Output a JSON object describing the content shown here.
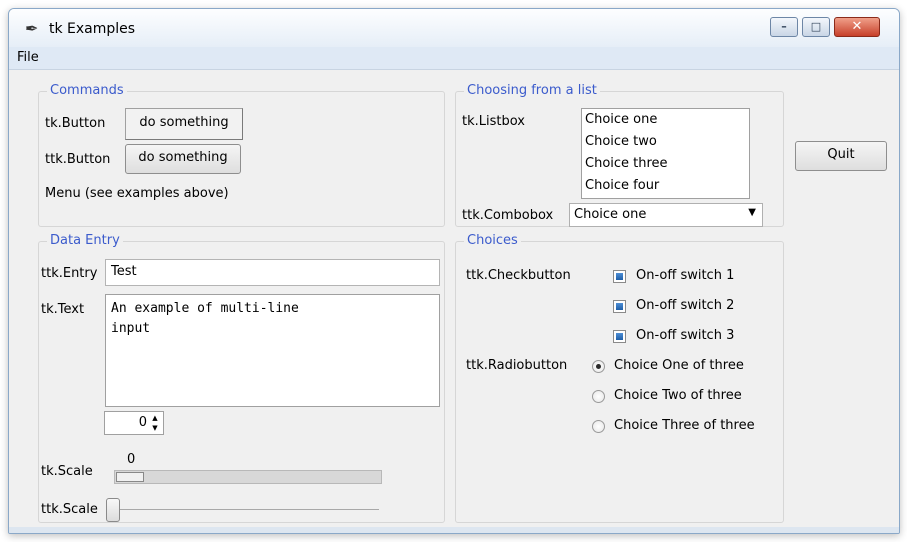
{
  "window": {
    "title": "tk Examples",
    "icon": "feather-icon",
    "controls": [
      "minimize-icon",
      "maximize-icon",
      "close-icon"
    ]
  },
  "menubar": {
    "items": [
      "File"
    ]
  },
  "commands": {
    "legend": "Commands",
    "tk_button_label": "tk.Button",
    "tk_button_text": "do something",
    "ttk_button_label": "ttk.Button",
    "ttk_button_text": "do something",
    "menu_note": "Menu (see examples above)"
  },
  "list": {
    "legend": "Choosing from a list",
    "listbox_label": "tk.Listbox",
    "listbox_items": [
      "Choice one",
      "Choice two",
      "Choice three",
      "Choice four"
    ],
    "combobox_label": "ttk.Combobox",
    "combobox_value": "Choice one"
  },
  "quit_label": "Quit",
  "data_entry": {
    "legend": "Data Entry",
    "entry_label": "ttk.Entry",
    "entry_value": "Test",
    "text_label": "tk.Text",
    "text_line1": "An example of multi-line",
    "text_line2": "input",
    "spinbox_value": "0",
    "tk_scale_label": "tk.Scale",
    "tk_scale_value": "0",
    "ttk_scale_label": "ttk.Scale"
  },
  "choices": {
    "legend": "Choices",
    "checkbutton_label": "ttk.Checkbutton",
    "checkbuttons": [
      {
        "label": "On-off switch 1",
        "checked": true
      },
      {
        "label": "On-off switch 2",
        "checked": true
      },
      {
        "label": "On-off switch 3",
        "checked": true
      }
    ],
    "radiobutton_label": "ttk.Radiobutton",
    "radiobuttons": [
      {
        "label": "Choice One of three",
        "selected": true
      },
      {
        "label": "Choice Two of three",
        "selected": false
      },
      {
        "label": "Choice Three of three",
        "selected": false
      }
    ]
  },
  "colors": {
    "legend": "#3b5bcc",
    "checkbox_fill": "#1f5fa8",
    "close_button": "#c7402a"
  }
}
